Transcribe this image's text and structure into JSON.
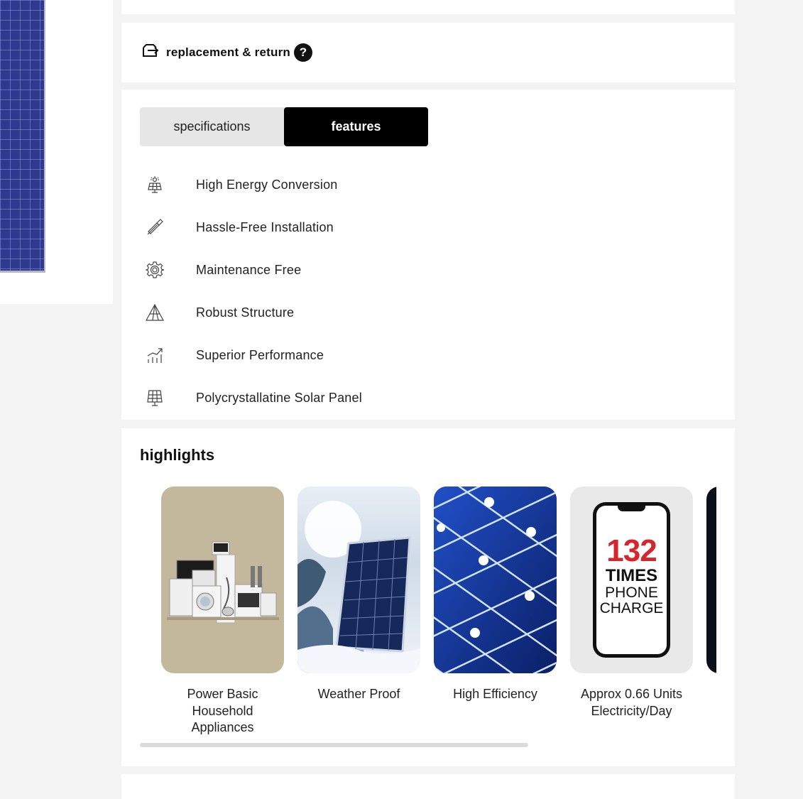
{
  "return_policy": {
    "label": "replacement & return",
    "help_glyph": "?"
  },
  "tabs": {
    "specifications": "specifications",
    "features": "features",
    "active": "features"
  },
  "features": [
    {
      "icon": "sun-panel-icon",
      "label": "High Energy Conversion"
    },
    {
      "icon": "screwdriver-icon",
      "label": "Hassle-Free Installation"
    },
    {
      "icon": "gear-icon",
      "label": "Maintenance Free"
    },
    {
      "icon": "pyramid-structure-icon",
      "label": "Robust Structure"
    },
    {
      "icon": "growth-chart-icon",
      "label": "Superior Performance"
    },
    {
      "icon": "solar-panel-icon",
      "label": "Polycrystallatine Solar Panel"
    }
  ],
  "highlights": {
    "title": "highlights",
    "items": [
      {
        "caption": "Power Basic Household Appliances"
      },
      {
        "caption": "Weather Proof"
      },
      {
        "caption": "High Efficiency"
      },
      {
        "caption": "Approx 0.66 Units Electricity/Day",
        "phone_text": {
          "number": "132",
          "line1": "TIMES",
          "line2": "PHONE",
          "line3": "CHARGE"
        }
      }
    ]
  },
  "colors": {
    "accent": "#000000",
    "phone_number": "#d7262b",
    "panel_blue": "#2f3a8f",
    "page_bg": "#f3f3f3"
  }
}
